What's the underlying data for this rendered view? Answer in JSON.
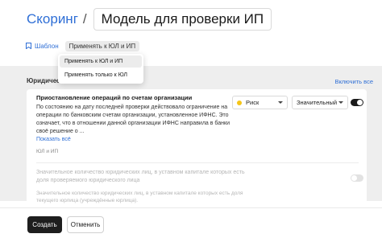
{
  "header": {
    "breadcrumb": "Скоринг",
    "separator": "/",
    "title": "Модель для проверки ИП"
  },
  "subbar": {
    "template_label": "Шаблон",
    "template_icon": "bookmark-icon",
    "apply_label": "Применять к ЮЛ и ИП"
  },
  "dropdown": {
    "items": [
      {
        "label": "Применять к ЮЛ и ИП",
        "selected": true
      },
      {
        "label": "Применять только к ЮЛ",
        "selected": false
      }
    ]
  },
  "section": {
    "label": "Юридичес",
    "enable_all": "Включить все"
  },
  "items": [
    {
      "title": "Приостановление операций по счетам организации",
      "description": "По состоянию на дату последней проверки действовало ограничение на операции по банковским счетам организации, установленное ИФНС. Это означает, что в отношении данной организации ИФНС направила в банки своё решение о ...",
      "show_all": "Показать всё",
      "tag": "ЮЛ и ИП",
      "risk": "Риск",
      "risk_color": "#f5c518",
      "level": "Значительный",
      "enabled": true
    },
    {
      "title": "Значительное количество юридических лиц, в уставном капитале которых есть доля проверяемого юридического лица",
      "description": "Значительное количество юридических лиц, в уставном капитале которых есть доля текущего юрлица (учреждённые юрлица).",
      "enabled": false
    }
  ],
  "footer": {
    "create_label": "Создать",
    "cancel_label": "Отменить"
  },
  "colors": {
    "accent": "#2f6fd6",
    "primary_button": "#1e1e1e"
  }
}
